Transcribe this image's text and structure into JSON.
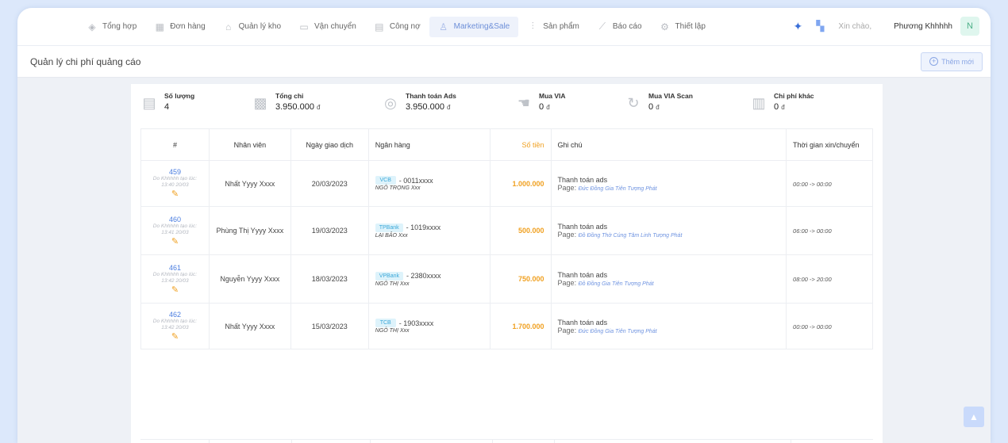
{
  "nav": {
    "items": [
      {
        "label": "Tổng hợp",
        "icon": "cube-icon",
        "glyph": "◈"
      },
      {
        "label": "Đơn hàng",
        "icon": "calendar-icon",
        "glyph": "▦"
      },
      {
        "label": "Quản lý kho",
        "icon": "warehouse-icon",
        "glyph": "⌂"
      },
      {
        "label": "Vận chuyển",
        "icon": "truck-icon",
        "glyph": "▭"
      },
      {
        "label": "Công nợ",
        "icon": "ledger-icon",
        "glyph": "▤"
      },
      {
        "label": "Marketing&Sale",
        "icon": "people-icon",
        "glyph": "♙",
        "active": true
      },
      {
        "label": "Sản phẩm",
        "icon": "products-icon",
        "glyph": "⫶"
      },
      {
        "label": "Báo cáo",
        "icon": "chart-icon",
        "glyph": "⟋"
      },
      {
        "label": "Thiết lập",
        "icon": "gear-icon",
        "glyph": "⚙"
      }
    ],
    "greeting": "Xin chào,",
    "user_name": "Phương Khhhhh",
    "avatar_letter": "N"
  },
  "subheader": {
    "title": "Quản lý chi phí quảng cáo",
    "add_label": "Thêm mới"
  },
  "stats": [
    {
      "label": "Số lượng",
      "value": "4",
      "unit": "",
      "icon": "document-icon",
      "glyph": "▤"
    },
    {
      "label": "Tổng chi",
      "value": "3.950.000",
      "unit": "đ",
      "icon": "grid-icon",
      "glyph": "▩"
    },
    {
      "label": "Thanh toán Ads",
      "value": "3.950.000",
      "unit": "đ",
      "icon": "coin-icon",
      "glyph": "◎"
    },
    {
      "label": "Mua VIA",
      "value": "0",
      "unit": "đ",
      "icon": "hand-icon",
      "glyph": "☚"
    },
    {
      "label": "Mua VIA Scan",
      "value": "0",
      "unit": "đ",
      "icon": "refresh-icon",
      "glyph": "↻"
    },
    {
      "label": "Chi phí khác",
      "value": "0",
      "unit": "đ",
      "icon": "file-icon",
      "glyph": "▥"
    }
  ],
  "table": {
    "headers": {
      "id": "#",
      "employee": "Nhân viên",
      "date": "Ngày giao dịch",
      "bank": "Ngân hàng",
      "amount": "Số tiền",
      "note": "Ghi chú",
      "time": "Thời gian xin/chuyển"
    },
    "rows": [
      {
        "id": "459",
        "creator": "Do Khhhhh tạo lúc: 13:40 20/03",
        "employee": "Nhất Yyyy Xxxx",
        "date": "20/03/2023",
        "bank_code": "VCB",
        "account": "- 0011xxxx",
        "holder": "NGÔ TRỌNG Xxx",
        "amount": "1.000.000",
        "note_title": "Thanh toán ads",
        "page_label": "Page:",
        "page_name": "Đức Đồng Gia Tiên Tượng Phát",
        "time": "00:00 -> 00:00"
      },
      {
        "id": "460",
        "creator": "Do Khhhhh tạo lúc: 13:41 20/03",
        "employee": "Phùng Thị Yyyy Xxxx",
        "date": "19/03/2023",
        "bank_code": "TPBank",
        "account": "- 1019xxxx",
        "holder": "LẠI BẢO Xxx",
        "amount": "500.000",
        "note_title": "Thanh toán ads",
        "page_label": "Page:",
        "page_name": "Đồ Đồng Thờ Cúng Tâm Linh Tượng Phát",
        "time": "06:00 -> 00:00"
      },
      {
        "id": "461",
        "creator": "Do Khhhhh tạo lúc: 13:42 20/03",
        "employee": "Nguyễn Yyyy Xxxx",
        "date": "18/03/2023",
        "bank_code": "VPBank",
        "account": "- 2380xxxx",
        "holder": "NGÔ THỊ Xxx",
        "amount": "750.000",
        "note_title": "Thanh toán ads",
        "page_label": "Page:",
        "page_name": "Đồ Đồng Gia Tiên Tượng Phát",
        "time": "08:00 -> 20:00"
      },
      {
        "id": "462",
        "creator": "Do Khhhhh tạo lúc: 13:42 20/03",
        "employee": "Nhất Yyyy Xxxx",
        "date": "15/03/2023",
        "bank_code": "TCB",
        "account": "- 1903xxxx",
        "holder": "NGÔ THỊ Xxx",
        "amount": "1.700.000",
        "note_title": "Thanh toán ads",
        "page_label": "Page:",
        "page_name": "Đức Đồng Gia Tiên Tượng Phát",
        "time": "00:00 -> 00:00"
      }
    ]
  },
  "colors": {
    "accent": "#6d8fd8",
    "amount": "#f0a020",
    "link": "#4a7de0"
  }
}
